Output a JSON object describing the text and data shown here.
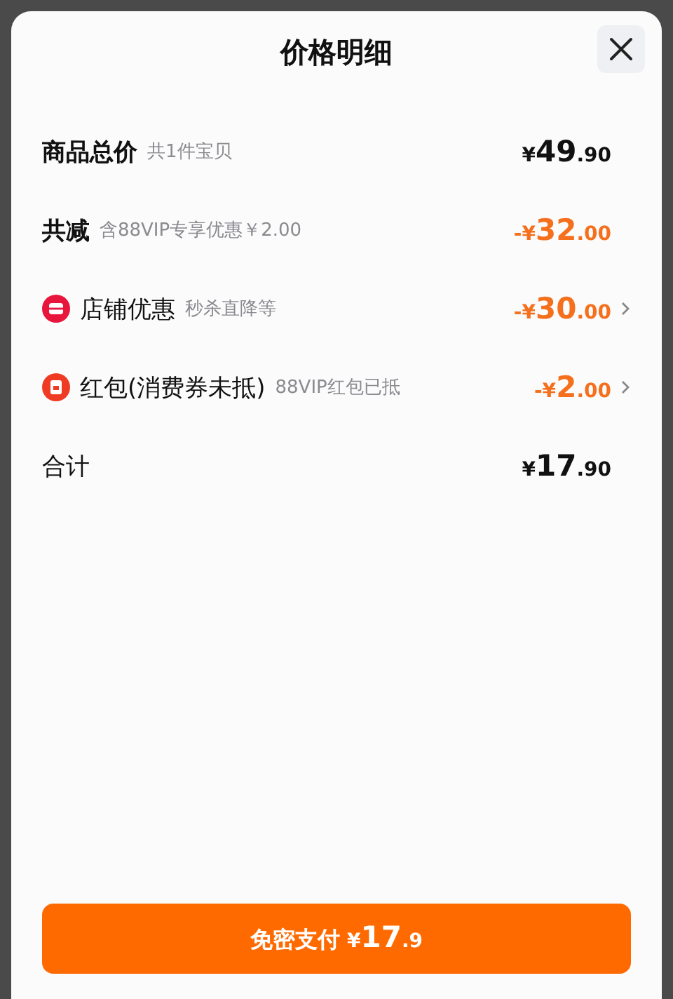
{
  "sheet": {
    "title": "价格明细"
  },
  "rows": [
    {
      "kind": "subtotal",
      "label": "商品总价",
      "note": "共1件宝贝",
      "amount": {
        "prefix": "¥",
        "main": "49",
        "fraction": ".90"
      },
      "highlight": false,
      "chevron": false
    },
    {
      "kind": "saving",
      "label": "共减",
      "note": "含88VIP专享优惠￥2.00",
      "amount": {
        "prefix": "-¥",
        "main": "32",
        "fraction": ".00"
      },
      "highlight": true,
      "chevron": false
    },
    {
      "kind": "shop",
      "label": "店铺优惠",
      "note": "秒杀直降等",
      "amount": {
        "prefix": "-¥",
        "main": "30",
        "fraction": ".00"
      },
      "highlight": true,
      "chevron": true
    },
    {
      "kind": "voucher",
      "label": "红包(消费券未抵)",
      "note": "88VIP红包已抵",
      "amount": {
        "prefix": "-¥",
        "main": "2",
        "fraction": ".00"
      },
      "highlight": true,
      "chevron": true
    },
    {
      "kind": "total",
      "label": "合计",
      "amount": {
        "prefix": "¥",
        "main": "17",
        "fraction": ".90"
      },
      "highlight": false,
      "chevron": false
    }
  ],
  "pay_button": {
    "label": "免密支付",
    "prefix": "¥",
    "main": "17",
    "fraction": ".9"
  }
}
